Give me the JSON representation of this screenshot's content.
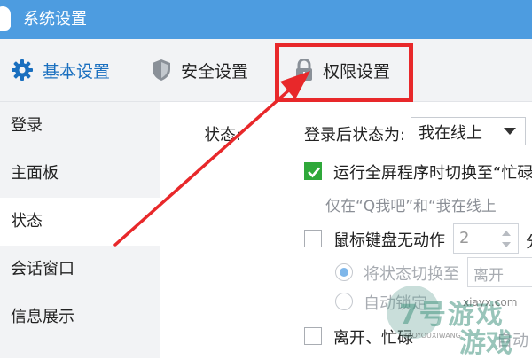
{
  "window": {
    "title": "系统设置"
  },
  "tabs": [
    {
      "label": "基本设置",
      "icon": "gear-icon",
      "active": true
    },
    {
      "label": "安全设置",
      "icon": "shield-icon",
      "active": false
    },
    {
      "label": "权限设置",
      "icon": "lock-icon",
      "active": false
    }
  ],
  "sidebar": {
    "items": [
      {
        "label": "登录"
      },
      {
        "label": "主面板"
      },
      {
        "label": "状态",
        "active": true
      },
      {
        "label": "会话窗口"
      },
      {
        "label": "信息展示"
      }
    ]
  },
  "status": {
    "section_label": "状态:",
    "login_status_label": "登录后状态为:",
    "login_status_value": "我在线上",
    "fullscreen_switch_label": "运行全屏程序时切换至“忙碌",
    "fullscreen_switch_checked": true,
    "fullscreen_note": "仅在“Q我吧”和“我在线上",
    "idle_label": "鼠标键盘无动作",
    "idle_checked": false,
    "idle_minutes": "2",
    "idle_unit": "分",
    "switch_status_label": "将状态切换至",
    "switch_status_value": "离开",
    "auto_lock_label": "自动锁定",
    "away_label": "离开、忙碌",
    "away_suffix": "自动",
    "away_checked": false
  },
  "watermark": {
    "logo_text": "7号游戏",
    "domain": "xiayx.com",
    "sub_text": "7HAOYOUXIWANG",
    "logo_text2": "游戏"
  },
  "colors": {
    "titlebar": "#4d9ce0",
    "active_tab": "#1a6fbf",
    "highlight_box": "#e8282a",
    "arrow": "#e8282a",
    "checked": "#2fa83a"
  }
}
